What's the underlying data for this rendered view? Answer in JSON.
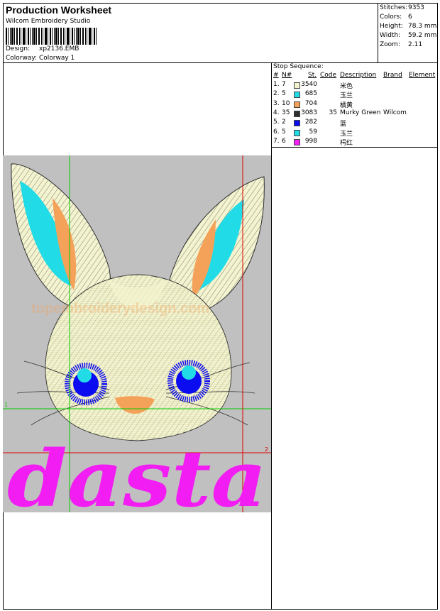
{
  "header": {
    "title": "Production Worksheet",
    "software": "Wilcom Embroidery Studio",
    "design_label": "Design:",
    "design_value": "xp2136.EMB",
    "colorway_label": "Colorway:",
    "colorway_value": "Colorway 1"
  },
  "stats": [
    {
      "label": "Stitches:",
      "value": "9353"
    },
    {
      "label": "Colors:",
      "value": "6"
    },
    {
      "label": "Height:",
      "value": "78.3 mm"
    },
    {
      "label": "Width:",
      "value": "59.2 mm"
    },
    {
      "label": "Zoom:",
      "value": "2.11"
    }
  ],
  "stop_sequence": {
    "caption": "Stop Sequence:",
    "columns": [
      "#",
      "N#",
      "St.",
      "Code",
      "Description",
      "Brand",
      "Element"
    ],
    "rows": [
      {
        "idx": "1.",
        "n": "7",
        "color": "#f3f3cf",
        "st": "3540",
        "code": "",
        "desc": "米色",
        "brand": ""
      },
      {
        "idx": "2.",
        "n": "5",
        "color": "#21dce6",
        "st": "685",
        "code": "",
        "desc": "玉兰",
        "brand": ""
      },
      {
        "idx": "3.",
        "n": "10",
        "color": "#f4a259",
        "st": "704",
        "code": "",
        "desc": "橘黄",
        "brand": ""
      },
      {
        "idx": "4.",
        "n": "35",
        "color": "#2d2f30",
        "st": "3083",
        "code": "35",
        "desc": "Murky Green",
        "brand": "Wilcom"
      },
      {
        "idx": "5.",
        "n": "2",
        "color": "#0c0cf0",
        "st": "282",
        "code": "",
        "desc": "蓝",
        "brand": ""
      },
      {
        "idx": "6.",
        "n": "5",
        "color": "#21dce6",
        "st": "59",
        "code": "",
        "desc": "玉兰",
        "brand": ""
      },
      {
        "idx": "7.",
        "n": "6",
        "color": "#f21df2",
        "st": "998",
        "code": "",
        "desc": "枵红",
        "brand": ""
      }
    ]
  },
  "design": {
    "text": "dasta",
    "watermark": "topembroiderydesign.com",
    "marker_green": "1",
    "marker_red": "2",
    "colors": {
      "fur": "#f3f3cf",
      "ear": "#21dce6",
      "ear_inner": "#f4a259",
      "outline": "#2d2f30",
      "eye": "#0c0cf0",
      "text": "#f21df2",
      "bg": "#c0c0c0"
    }
  }
}
